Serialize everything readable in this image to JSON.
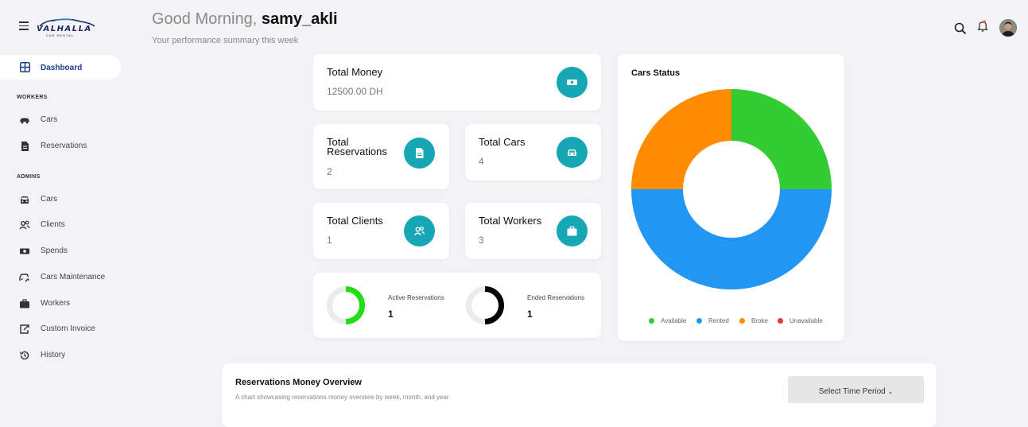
{
  "app": {
    "logo_text": "VALHALLA",
    "logo_sub": "CAR RENTAL"
  },
  "sidebar": {
    "active": {
      "label": "Dashboard",
      "icon": "grid-icon"
    },
    "workers_title": "WORKERS",
    "workers_items": [
      {
        "label": "Cars",
        "icon": "car-icon"
      },
      {
        "label": "Reservations",
        "icon": "document-icon"
      }
    ],
    "admins_title": "ADMINS",
    "admins_items": [
      {
        "label": "Cars",
        "icon": "car-front-icon"
      },
      {
        "label": "Clients",
        "icon": "users-icon"
      },
      {
        "label": "Spends",
        "icon": "money-icon"
      },
      {
        "label": "Cars Maintenance",
        "icon": "car-wrench-icon"
      },
      {
        "label": "Workers",
        "icon": "briefcase-icon"
      },
      {
        "label": "Custom Invoice",
        "icon": "invoice-icon"
      },
      {
        "label": "History",
        "icon": "history-icon"
      }
    ]
  },
  "header": {
    "greeting": "Good Morning,",
    "username": "samy_akli",
    "subtitle": "Your performance summary this week"
  },
  "cards": {
    "total_money": {
      "title": "Total Money",
      "value": "12500.00 DH",
      "icon": "money-icon"
    },
    "total_reservations": {
      "title_line1": "Total",
      "title_line2": "Reservations",
      "value": "2",
      "icon": "document-icon"
    },
    "total_cars": {
      "title": "Total Cars",
      "value": "4",
      "icon": "car-icon"
    },
    "total_clients": {
      "title": "Total Clients",
      "value": "1",
      "icon": "users-icon"
    },
    "total_workers": {
      "title": "Total Workers",
      "value": "3",
      "icon": "briefcase-icon"
    }
  },
  "reservations_mini": {
    "active": {
      "label": "Active Reservations",
      "value": "1",
      "fraction": 0.5,
      "color": "#22dd11"
    },
    "ended": {
      "label": "Ended Reservations",
      "value": "1",
      "fraction": 0.5,
      "color": "#000000"
    }
  },
  "cars_status": {
    "title": "Cars Status",
    "legend": [
      {
        "label": "Available",
        "color": "#33cc33"
      },
      {
        "label": "Rented",
        "color": "#2196f3"
      },
      {
        "label": "Broke",
        "color": "#ff8c00"
      },
      {
        "label": "Unavailable",
        "color": "#e53935"
      }
    ]
  },
  "chart_data": {
    "type": "pie",
    "title": "Cars Status",
    "categories": [
      "Available",
      "Rented",
      "Broke",
      "Unavailable"
    ],
    "values": [
      1,
      2,
      1,
      0
    ],
    "colors": [
      "#33cc33",
      "#2196f3",
      "#ff8c00",
      "#e53935"
    ],
    "legend_position": "bottom"
  },
  "overview": {
    "title": "Reservations Money Overview",
    "subtitle": "A chart showcasing reservations money overview by week, month, and year",
    "select_label": "Select Time Period"
  }
}
